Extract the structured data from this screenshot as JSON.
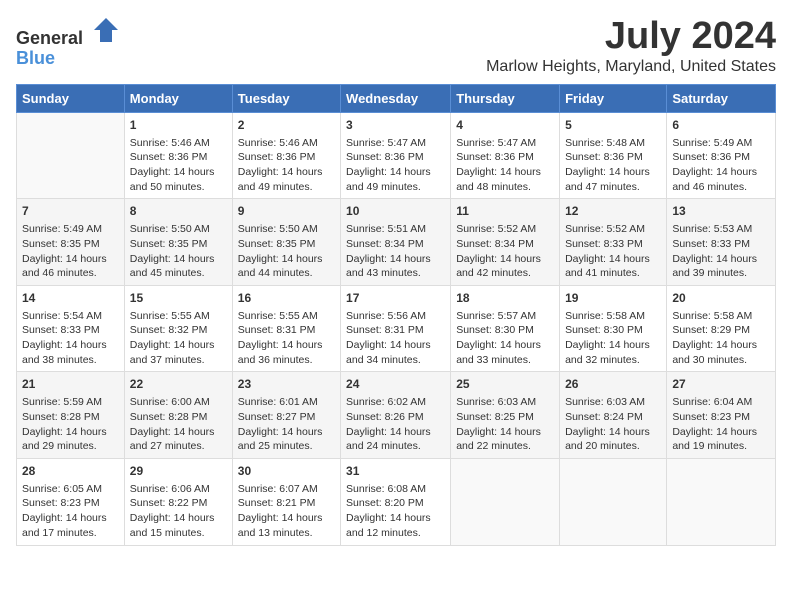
{
  "header": {
    "logo_general": "General",
    "logo_blue": "Blue",
    "month_year": "July 2024",
    "location": "Marlow Heights, Maryland, United States"
  },
  "days_of_week": [
    "Sunday",
    "Monday",
    "Tuesday",
    "Wednesday",
    "Thursday",
    "Friday",
    "Saturday"
  ],
  "weeks": [
    [
      {
        "day": "",
        "content": ""
      },
      {
        "day": "1",
        "content": "Sunrise: 5:46 AM\nSunset: 8:36 PM\nDaylight: 14 hours\nand 50 minutes."
      },
      {
        "day": "2",
        "content": "Sunrise: 5:46 AM\nSunset: 8:36 PM\nDaylight: 14 hours\nand 49 minutes."
      },
      {
        "day": "3",
        "content": "Sunrise: 5:47 AM\nSunset: 8:36 PM\nDaylight: 14 hours\nand 49 minutes."
      },
      {
        "day": "4",
        "content": "Sunrise: 5:47 AM\nSunset: 8:36 PM\nDaylight: 14 hours\nand 48 minutes."
      },
      {
        "day": "5",
        "content": "Sunrise: 5:48 AM\nSunset: 8:36 PM\nDaylight: 14 hours\nand 47 minutes."
      },
      {
        "day": "6",
        "content": "Sunrise: 5:49 AM\nSunset: 8:36 PM\nDaylight: 14 hours\nand 46 minutes."
      }
    ],
    [
      {
        "day": "7",
        "content": "Sunrise: 5:49 AM\nSunset: 8:35 PM\nDaylight: 14 hours\nand 46 minutes."
      },
      {
        "day": "8",
        "content": "Sunrise: 5:50 AM\nSunset: 8:35 PM\nDaylight: 14 hours\nand 45 minutes."
      },
      {
        "day": "9",
        "content": "Sunrise: 5:50 AM\nSunset: 8:35 PM\nDaylight: 14 hours\nand 44 minutes."
      },
      {
        "day": "10",
        "content": "Sunrise: 5:51 AM\nSunset: 8:34 PM\nDaylight: 14 hours\nand 43 minutes."
      },
      {
        "day": "11",
        "content": "Sunrise: 5:52 AM\nSunset: 8:34 PM\nDaylight: 14 hours\nand 42 minutes."
      },
      {
        "day": "12",
        "content": "Sunrise: 5:52 AM\nSunset: 8:33 PM\nDaylight: 14 hours\nand 41 minutes."
      },
      {
        "day": "13",
        "content": "Sunrise: 5:53 AM\nSunset: 8:33 PM\nDaylight: 14 hours\nand 39 minutes."
      }
    ],
    [
      {
        "day": "14",
        "content": "Sunrise: 5:54 AM\nSunset: 8:33 PM\nDaylight: 14 hours\nand 38 minutes."
      },
      {
        "day": "15",
        "content": "Sunrise: 5:55 AM\nSunset: 8:32 PM\nDaylight: 14 hours\nand 37 minutes."
      },
      {
        "day": "16",
        "content": "Sunrise: 5:55 AM\nSunset: 8:31 PM\nDaylight: 14 hours\nand 36 minutes."
      },
      {
        "day": "17",
        "content": "Sunrise: 5:56 AM\nSunset: 8:31 PM\nDaylight: 14 hours\nand 34 minutes."
      },
      {
        "day": "18",
        "content": "Sunrise: 5:57 AM\nSunset: 8:30 PM\nDaylight: 14 hours\nand 33 minutes."
      },
      {
        "day": "19",
        "content": "Sunrise: 5:58 AM\nSunset: 8:30 PM\nDaylight: 14 hours\nand 32 minutes."
      },
      {
        "day": "20",
        "content": "Sunrise: 5:58 AM\nSunset: 8:29 PM\nDaylight: 14 hours\nand 30 minutes."
      }
    ],
    [
      {
        "day": "21",
        "content": "Sunrise: 5:59 AM\nSunset: 8:28 PM\nDaylight: 14 hours\nand 29 minutes."
      },
      {
        "day": "22",
        "content": "Sunrise: 6:00 AM\nSunset: 8:28 PM\nDaylight: 14 hours\nand 27 minutes."
      },
      {
        "day": "23",
        "content": "Sunrise: 6:01 AM\nSunset: 8:27 PM\nDaylight: 14 hours\nand 25 minutes."
      },
      {
        "day": "24",
        "content": "Sunrise: 6:02 AM\nSunset: 8:26 PM\nDaylight: 14 hours\nand 24 minutes."
      },
      {
        "day": "25",
        "content": "Sunrise: 6:03 AM\nSunset: 8:25 PM\nDaylight: 14 hours\nand 22 minutes."
      },
      {
        "day": "26",
        "content": "Sunrise: 6:03 AM\nSunset: 8:24 PM\nDaylight: 14 hours\nand 20 minutes."
      },
      {
        "day": "27",
        "content": "Sunrise: 6:04 AM\nSunset: 8:23 PM\nDaylight: 14 hours\nand 19 minutes."
      }
    ],
    [
      {
        "day": "28",
        "content": "Sunrise: 6:05 AM\nSunset: 8:23 PM\nDaylight: 14 hours\nand 17 minutes."
      },
      {
        "day": "29",
        "content": "Sunrise: 6:06 AM\nSunset: 8:22 PM\nDaylight: 14 hours\nand 15 minutes."
      },
      {
        "day": "30",
        "content": "Sunrise: 6:07 AM\nSunset: 8:21 PM\nDaylight: 14 hours\nand 13 minutes."
      },
      {
        "day": "31",
        "content": "Sunrise: 6:08 AM\nSunset: 8:20 PM\nDaylight: 14 hours\nand 12 minutes."
      },
      {
        "day": "",
        "content": ""
      },
      {
        "day": "",
        "content": ""
      },
      {
        "day": "",
        "content": ""
      }
    ]
  ]
}
